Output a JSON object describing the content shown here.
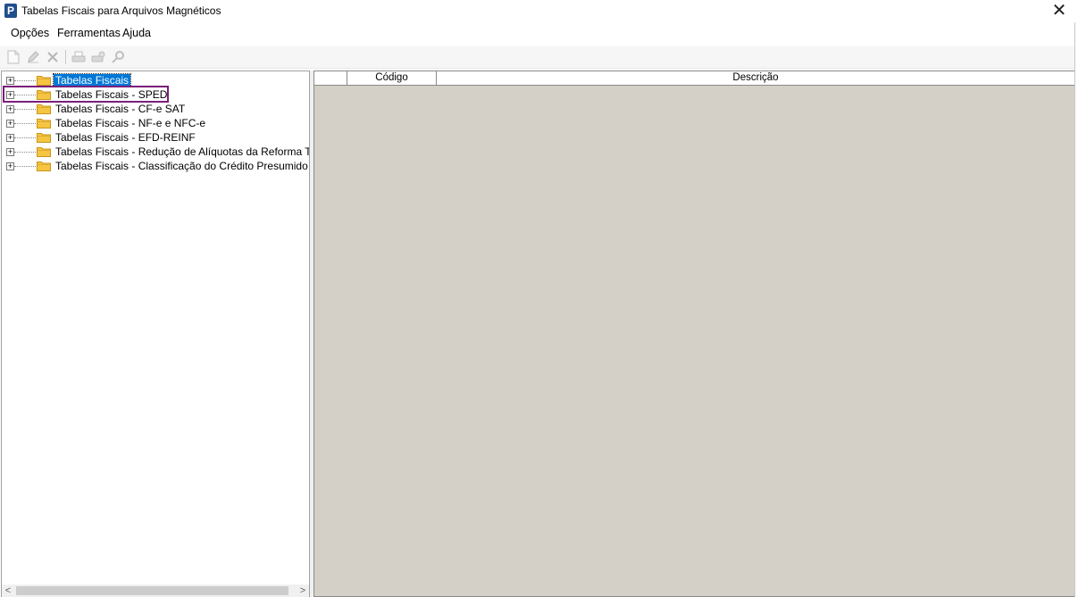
{
  "window": {
    "title": "Tabelas Fiscais para Arquivos Magnéticos",
    "app_icon_letter": "P",
    "close_glyph": "✕"
  },
  "menu": [
    {
      "label": "Opções"
    },
    {
      "label": "Ferramentas"
    },
    {
      "label": "Ajuda"
    }
  ],
  "toolbar": {
    "icons": [
      "new-document-icon",
      "edit-pencil-icon",
      "delete-x-icon",
      "print-icon",
      "print-setup-icon",
      "search-icon"
    ]
  },
  "tree": {
    "expander_glyph": "+",
    "items": [
      {
        "label": "Tabelas Fiscais",
        "selected": true
      },
      {
        "label": "Tabelas Fiscais - SPED",
        "highlighted": true
      },
      {
        "label": "Tabelas Fiscais - CF-e SAT"
      },
      {
        "label": "Tabelas Fiscais - NF-e e NFC-e"
      },
      {
        "label": "Tabelas Fiscais - EFD-REINF"
      },
      {
        "label": "Tabelas Fiscais - Redução de Alíquotas da Reforma Tributári"
      },
      {
        "label": "Tabelas Fiscais - Classificação do Crédito Presumido"
      }
    ]
  },
  "scroll": {
    "left_glyph": "<",
    "right_glyph": ">"
  },
  "grid": {
    "columns": [
      {
        "label": ""
      },
      {
        "label": "Código"
      },
      {
        "label": "Descrição"
      }
    ]
  },
  "colors": {
    "selection": "#0078d7",
    "highlight_box": "#7b1e7a",
    "grid_background": "#d4d0c8",
    "folder": "#f5c542"
  }
}
